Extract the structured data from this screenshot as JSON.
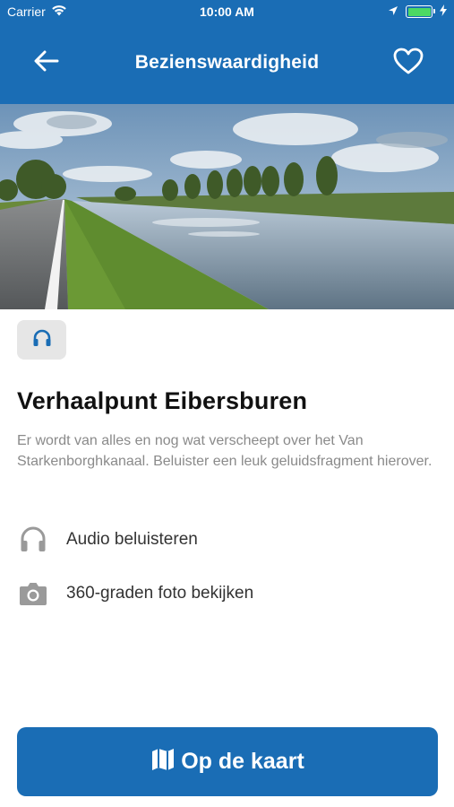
{
  "status_bar": {
    "carrier": "Carrier",
    "time": "10:00 AM"
  },
  "nav": {
    "title": "Bezienswaardigheid"
  },
  "poi": {
    "title": "Verhaalpunt Eibersburen",
    "description": "Er wordt van alles en nog wat verscheept over het Van Starkenborghkanaal. Beluister een leuk geluidsfragment hierover."
  },
  "actions": {
    "audio_label": "Audio beluisteren",
    "photo_label": "360-graden foto bekijken"
  },
  "map_button": {
    "label": "Op de kaart"
  },
  "colors": {
    "brand_blue": "#1a6db5",
    "badge_gray": "#e6e6e6",
    "text_gray": "#8a8a8a",
    "battery_green": "#4cd964"
  },
  "icons": {
    "back": "arrow-left-icon",
    "favorite": "heart-outline-icon",
    "audio_badge": "headphones-icon",
    "audio_row": "headphones-icon",
    "photo_row": "camera-icon",
    "map": "map-icon"
  }
}
